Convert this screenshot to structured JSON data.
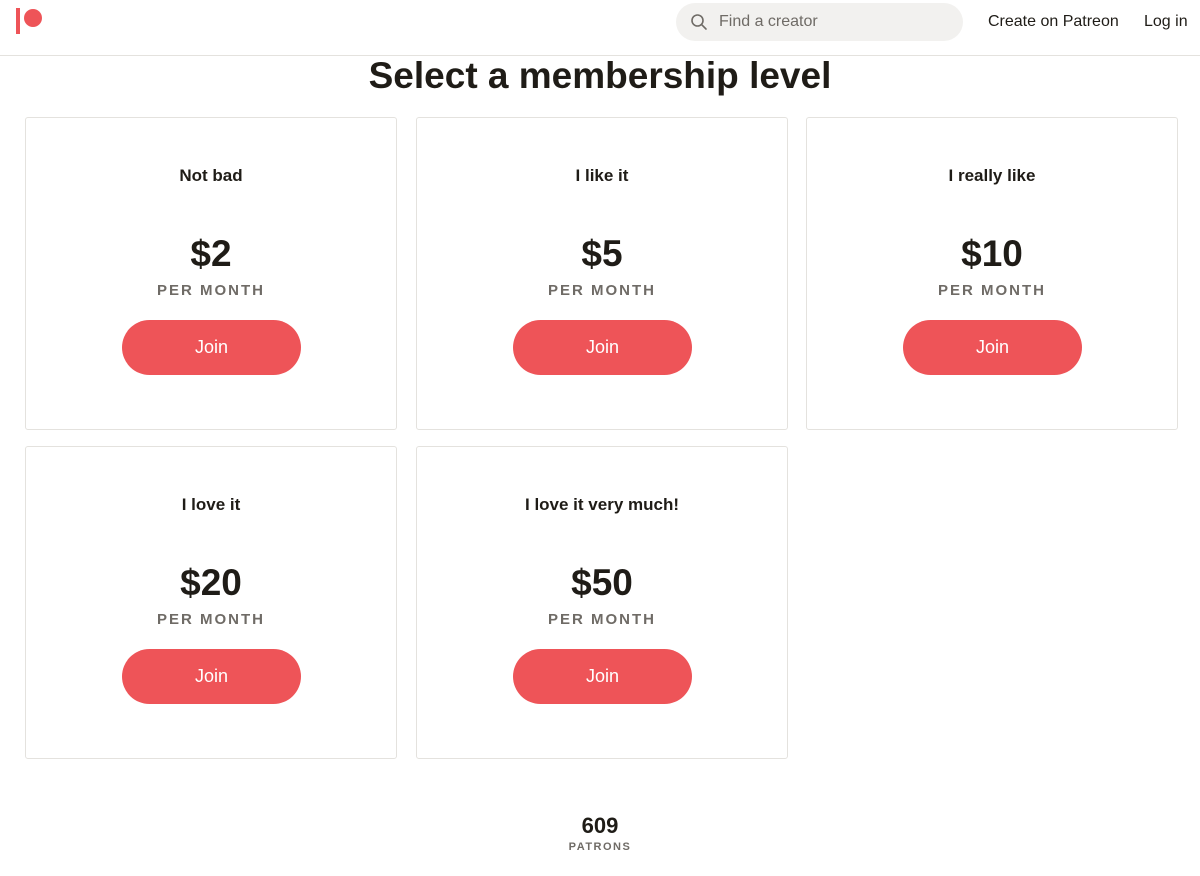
{
  "header": {
    "search_placeholder": "Find a creator",
    "create_link": "Create on Patreon",
    "login_link": "Log in",
    "logo_icon": "patreon-logo-icon",
    "search_icon": "search-icon"
  },
  "main": {
    "title": "Select a membership level",
    "tiers": [
      {
        "name": "Not bad",
        "price": "$2",
        "period": "PER MONTH",
        "button": "Join"
      },
      {
        "name": "I like it",
        "price": "$5",
        "period": "PER MONTH",
        "button": "Join"
      },
      {
        "name": "I really like",
        "price": "$10",
        "period": "PER MONTH",
        "button": "Join"
      },
      {
        "name": "I love it",
        "price": "$20",
        "period": "PER MONTH",
        "button": "Join"
      },
      {
        "name": "I love it very much!",
        "price": "$50",
        "period": "PER MONTH",
        "button": "Join"
      }
    ]
  },
  "footer": {
    "patron_count": "609",
    "patron_label": "PATRONS"
  },
  "colors": {
    "brand": "#ee5458",
    "text": "#1f1c17",
    "muted": "#6f6b66",
    "border": "#e4e2de"
  }
}
